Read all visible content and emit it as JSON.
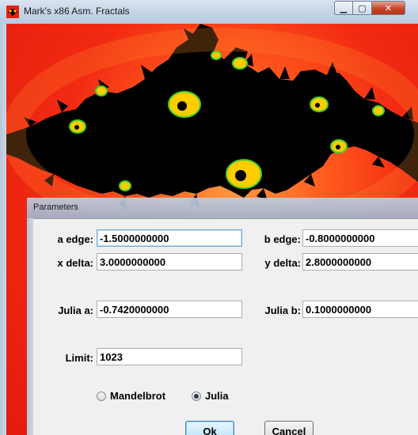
{
  "window": {
    "title": "Mark's x86 Asm. Fractals",
    "icon": "fractal-app-icon",
    "controls": {
      "minimize": "minimize-icon",
      "maximize": "maximize-icon",
      "close": "close-icon"
    }
  },
  "colors": {
    "fractal_bg": "#f22a12",
    "fractal_set": "#000000",
    "spiral": "#ffcc00",
    "spiral_edge": "#3fcf30"
  },
  "dialog": {
    "title": "Parameters",
    "fields": {
      "a_edge": {
        "label": "a edge:",
        "value": "-1.5000000000"
      },
      "b_edge": {
        "label": "b edge:",
        "value": "-0.8000000000"
      },
      "x_delta": {
        "label": "x delta:",
        "value": "3.0000000000"
      },
      "y_delta": {
        "label": "y delta:",
        "value": "2.8000000000"
      },
      "julia_a": {
        "label": "Julia a:",
        "value": "-0.7420000000"
      },
      "julia_b": {
        "label": "Julia b:",
        "value": "0.1000000000"
      },
      "limit": {
        "label": "Limit:",
        "value": "1023"
      }
    },
    "mode": {
      "options": [
        "Mandelbrot",
        "Julia"
      ],
      "selected": "Julia"
    },
    "buttons": {
      "ok": "Ok",
      "cancel": "Cancel"
    }
  }
}
